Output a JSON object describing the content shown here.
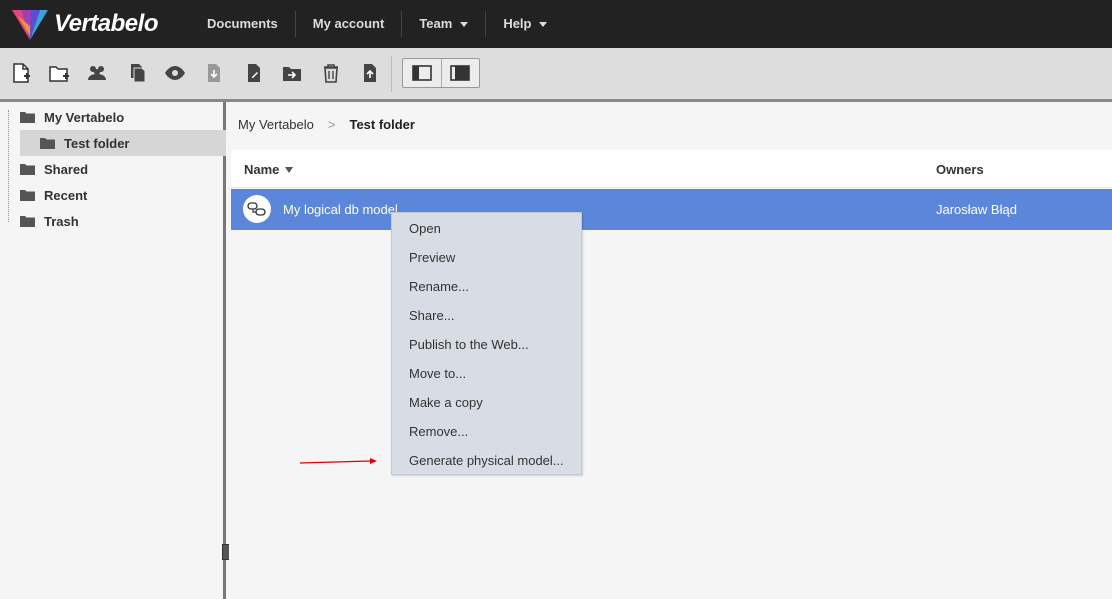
{
  "app": {
    "name": "Vertabelo"
  },
  "nav": {
    "items": [
      {
        "label": "Documents",
        "dropdown": false
      },
      {
        "label": "My account",
        "dropdown": false
      },
      {
        "label": "Team",
        "dropdown": true
      },
      {
        "label": "Help",
        "dropdown": true
      }
    ]
  },
  "toolbar": {
    "icons": [
      "new-document-icon",
      "new-folder-icon",
      "users-icon",
      "copy-icon",
      "preview-eye-icon",
      "download-icon",
      "edit-icon",
      "move-to-folder-icon",
      "trash-icon",
      "upload-icon"
    ],
    "view_icons": [
      "left-panel-icon",
      "right-panel-icon"
    ]
  },
  "sidebar": {
    "items": [
      {
        "label": "My Vertabelo",
        "level": 0
      },
      {
        "label": "Test folder",
        "level": 1,
        "selected": true
      },
      {
        "label": "Shared",
        "level": 0
      },
      {
        "label": "Recent",
        "level": 0
      },
      {
        "label": "Trash",
        "level": 0
      }
    ]
  },
  "breadcrumb": {
    "root": "My Vertabelo",
    "separator": ">",
    "current": "Test folder"
  },
  "table": {
    "columns": {
      "name": "Name",
      "owners": "Owners"
    },
    "rows": [
      {
        "name": "My logical db model",
        "owner": "Jarosław Błąd",
        "icon": "logical-model-icon"
      }
    ]
  },
  "context_menu": {
    "items": [
      "Open",
      "Preview",
      "Rename...",
      "Share...",
      "Publish to the Web...",
      "Move to...",
      "Make a copy",
      "Remove...",
      "Generate physical model..."
    ]
  },
  "colors": {
    "topbar": "#222222",
    "selected_row": "#5b86d9",
    "arrow": "#e00000",
    "menu_bg": "#d8dce4"
  }
}
